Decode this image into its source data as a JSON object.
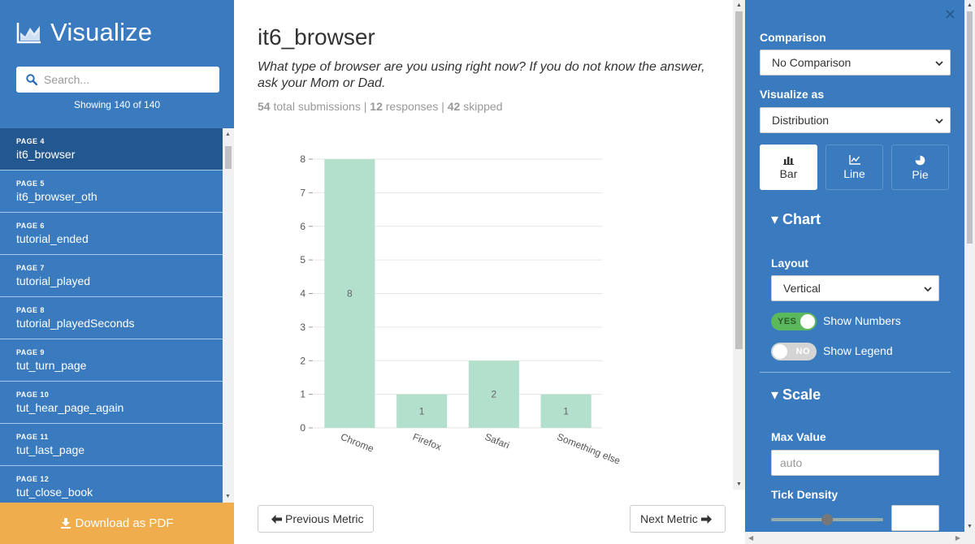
{
  "sidebar": {
    "brand": "Visualize",
    "search_placeholder": "Search...",
    "showing": "Showing 140 of 140",
    "items": [
      {
        "page": "PAGE 4",
        "name": "it6_browser",
        "active": true
      },
      {
        "page": "PAGE 5",
        "name": "it6_browser_oth"
      },
      {
        "page": "PAGE 6",
        "name": "tutorial_ended"
      },
      {
        "page": "PAGE 7",
        "name": "tutorial_played"
      },
      {
        "page": "PAGE 8",
        "name": "tutorial_playedSeconds"
      },
      {
        "page": "PAGE 9",
        "name": "tut_turn_page"
      },
      {
        "page": "PAGE 10",
        "name": "tut_hear_page_again"
      },
      {
        "page": "PAGE 11",
        "name": "tut_last_page"
      },
      {
        "page": "PAGE 12",
        "name": "tut_close_book"
      }
    ],
    "download_label": "Download as PDF"
  },
  "main": {
    "title": "it6_browser",
    "question": "What type of browser are you using right now? If you do not know the answer, ask your Mom or Dad.",
    "stats": {
      "total": "54",
      "total_label": "total submissions",
      "responses": "12",
      "responses_label": "responses",
      "skipped": "42",
      "skipped_label": "skipped"
    },
    "prev_label": "Previous Metric",
    "next_label": "Next Metric"
  },
  "chart_data": {
    "type": "bar",
    "categories": [
      "Chrome",
      "Firefox",
      "Safari",
      "Something else"
    ],
    "values": [
      8,
      1,
      2,
      1
    ],
    "ylim": [
      0,
      8
    ],
    "yticks": [
      0,
      1,
      2,
      3,
      4,
      5,
      6,
      7,
      8
    ],
    "show_numbers": true,
    "bar_color": "#b3e0cc",
    "grid": true
  },
  "panel": {
    "comparison_label": "Comparison",
    "comparison_value": "No Comparison",
    "visualize_label": "Visualize as",
    "visualize_value": "Distribution",
    "chart_types": [
      {
        "label": "Bar",
        "icon": "bar-chart-icon",
        "active": true
      },
      {
        "label": "Line",
        "icon": "line-chart-icon"
      },
      {
        "label": "Pie",
        "icon": "pie-chart-icon"
      }
    ],
    "chart_section": "Chart",
    "layout_label": "Layout",
    "layout_value": "Vertical",
    "show_numbers": {
      "state": "YES",
      "label": "Show Numbers"
    },
    "show_legend": {
      "state": "NO",
      "label": "Show Legend"
    },
    "scale_section": "Scale",
    "max_value_label": "Max Value",
    "max_value_placeholder": "auto",
    "tick_density_label": "Tick Density",
    "tick_density": 0.5
  },
  "colors": {
    "sidebar": "#3a7bbf",
    "active_item": "#23578f",
    "download": "#f0ad4e",
    "toggle_on": "#5cb85c"
  }
}
